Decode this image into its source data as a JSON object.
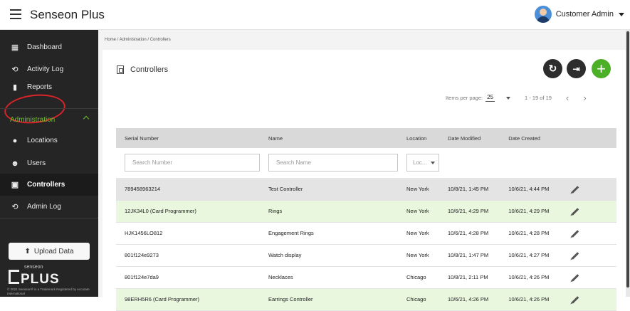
{
  "app": {
    "title": "Senseon Plus",
    "user_name": "Customer Admin"
  },
  "sidebar": {
    "items": [
      {
        "label": "Dashboard",
        "icon": "grid-icon"
      },
      {
        "label": "Activity Log",
        "icon": "history-icon"
      },
      {
        "label": "Reports",
        "icon": "bar-chart-icon"
      }
    ],
    "section_label": "Administration",
    "sub_items": [
      {
        "label": "Locations",
        "icon": "location-pin-icon"
      },
      {
        "label": "Users",
        "icon": "users-icon"
      },
      {
        "label": "Controllers",
        "icon": "document-icon"
      },
      {
        "label": "Admin Log",
        "icon": "history-icon"
      }
    ],
    "upload_label": "Upload Data",
    "brand_small": "senseon",
    "brand_big": "PLUS",
    "brand_tm": "© 2021 Senseon® is a Trademark Registered by Accurate International"
  },
  "breadcrumb": "Home / Administration / Controllers",
  "page": {
    "title": "Controllers"
  },
  "pager": {
    "items_per_page_label": "Items per page:",
    "items_per_page": "25",
    "range": "1 - 19 of 19"
  },
  "table": {
    "headers": [
      "Serial Number",
      "Name",
      "Location",
      "Date Modified",
      "Date Created"
    ],
    "filters": {
      "serial_placeholder": "Search Number",
      "name_placeholder": "Search Name",
      "location_placeholder": "Loc..."
    },
    "rows": [
      {
        "serial": "789458963214",
        "name": "Test Controller",
        "location": "New York",
        "modified": "10/8/21, 1:45 PM",
        "created": "10/6/21, 4:44 PM"
      },
      {
        "serial": "12JK34L0 (Card Programmer)",
        "name": "Rings",
        "location": "New York",
        "modified": "10/6/21, 4:29 PM",
        "created": "10/6/21, 4:29 PM"
      },
      {
        "serial": "HJK1456LO812",
        "name": "Engagement Rings",
        "location": "New York",
        "modified": "10/6/21, 4:28 PM",
        "created": "10/6/21, 4:28 PM"
      },
      {
        "serial": "801f124e9273",
        "name": "Watch display",
        "location": "New York",
        "modified": "10/8/21, 1:47 PM",
        "created": "10/6/21, 4:27 PM"
      },
      {
        "serial": "801f124e7da9",
        "name": "Necklaces",
        "location": "Chicago",
        "modified": "10/8/21, 2:11 PM",
        "created": "10/6/21, 4:26 PM"
      },
      {
        "serial": "98ERH5R6 (Card Programmer)",
        "name": "Earrings Controller",
        "location": "Chicago",
        "modified": "10/6/21, 4:26 PM",
        "created": "10/6/21, 4:26 PM"
      }
    ]
  },
  "colors": {
    "accent": "#4caf28",
    "sidebar": "#252525",
    "highlight": "#d8232a"
  }
}
